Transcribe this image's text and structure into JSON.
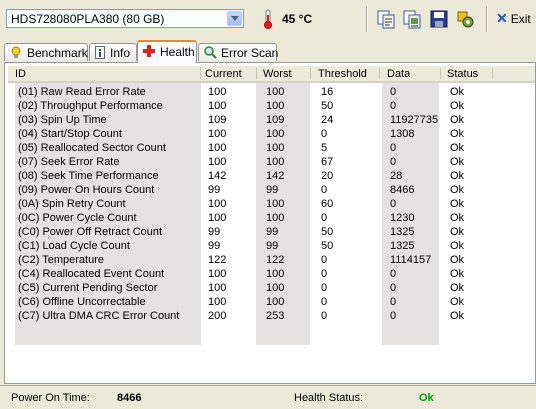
{
  "toolbar": {
    "drive": "HDS728080PLA380 (80 GB)",
    "temperature": "45 °C",
    "exit_label": "Exit"
  },
  "tabs": [
    {
      "label": "Benchmark",
      "icon": "lightbulb-icon"
    },
    {
      "label": "Info",
      "icon": "info-icon"
    },
    {
      "label": "Health",
      "icon": "health-cross-icon",
      "active": true
    },
    {
      "label": "Error Scan",
      "icon": "magnifier-icon"
    }
  ],
  "table": {
    "headers": [
      "ID",
      "Current",
      "Worst",
      "Threshold",
      "Data",
      "Status"
    ],
    "rows": [
      [
        "(01) Raw Read Error Rate",
        "100",
        "100",
        "16",
        "0",
        "Ok"
      ],
      [
        "(02) Throughput Performance",
        "100",
        "100",
        "50",
        "0",
        "Ok"
      ],
      [
        "(03) Spin Up Time",
        "109",
        "109",
        "24",
        "11927735",
        "Ok"
      ],
      [
        "(04) Start/Stop Count",
        "100",
        "100",
        "0",
        "1308",
        "Ok"
      ],
      [
        "(05) Reallocated Sector Count",
        "100",
        "100",
        "5",
        "0",
        "Ok"
      ],
      [
        "(07) Seek Error Rate",
        "100",
        "100",
        "67",
        "0",
        "Ok"
      ],
      [
        "(08) Seek Time Performance",
        "142",
        "142",
        "20",
        "28",
        "Ok"
      ],
      [
        "(09) Power On Hours Count",
        "99",
        "99",
        "0",
        "8466",
        "Ok"
      ],
      [
        "(0A) Spin Retry Count",
        "100",
        "100",
        "60",
        "0",
        "Ok"
      ],
      [
        "(0C) Power Cycle Count",
        "100",
        "100",
        "0",
        "1230",
        "Ok"
      ],
      [
        "(C0) Power Off Retract Count",
        "99",
        "99",
        "50",
        "1325",
        "Ok"
      ],
      [
        "(C1) Load Cycle Count",
        "99",
        "99",
        "50",
        "1325",
        "Ok"
      ],
      [
        "(C2) Temperature",
        "122",
        "122",
        "0",
        "1114157",
        "Ok"
      ],
      [
        "(C4) Reallocated Event Count",
        "100",
        "100",
        "0",
        "0",
        "Ok"
      ],
      [
        "(C5) Current Pending Sector",
        "100",
        "100",
        "0",
        "0",
        "Ok"
      ],
      [
        "(C6) Offline Uncorrectable",
        "100",
        "100",
        "0",
        "0",
        "Ok"
      ],
      [
        "(C7) Ultra DMA CRC Error Count",
        "200",
        "253",
        "0",
        "0",
        "Ok"
      ]
    ]
  },
  "status": {
    "power_on_label": "Power On Time:",
    "power_on_value": "8466",
    "health_label": "Health Status:",
    "health_value": "Ok",
    "health_color": "#00a000"
  }
}
